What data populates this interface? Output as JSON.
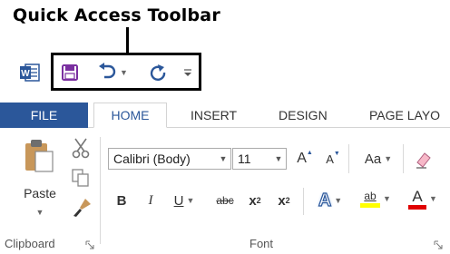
{
  "callout": {
    "title": "Quick Access Toolbar"
  },
  "app": {
    "name": "Word"
  },
  "qat": {
    "save_icon": "save-icon",
    "undo_icon": "undo-icon",
    "redo_icon": "redo-icon",
    "customize_icon": "customize-qat-icon"
  },
  "tabs": {
    "file": "FILE",
    "items": [
      "HOME",
      "INSERT",
      "DESIGN",
      "PAGE LAYO"
    ]
  },
  "clipboard": {
    "paste_label": "Paste",
    "group_label": "Clipboard"
  },
  "font": {
    "family": "Calibri (Body)",
    "size": "11",
    "group_label": "Font",
    "grow": "A",
    "shrink": "A",
    "change_case": "Aa",
    "bold": "B",
    "italic": "I",
    "underline": "U",
    "strikethrough": "abc",
    "subscript": "x",
    "subscript_digit": "2",
    "superscript": "x",
    "superscript_digit": "2",
    "text_effects": "A",
    "highlight": "ab",
    "font_color": "A"
  },
  "colors": {
    "accent": "#2b579a",
    "highlight": "#ffff00",
    "font_color": "#e00000",
    "save": "#7a2fa0"
  }
}
